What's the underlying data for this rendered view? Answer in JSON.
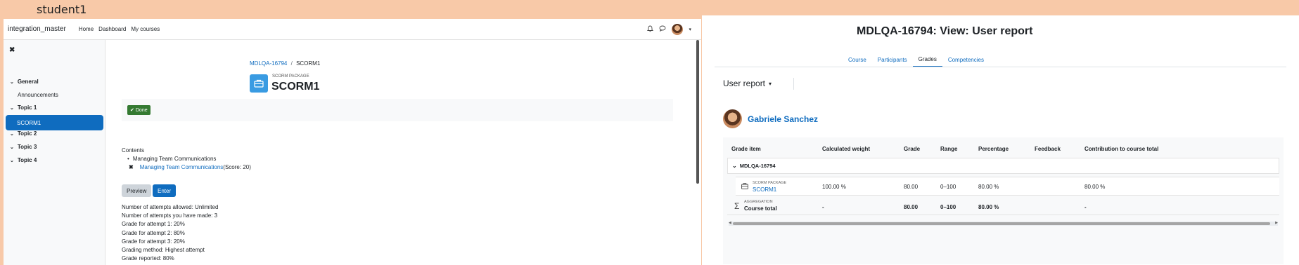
{
  "user_label": "student1",
  "left": {
    "navbar": {
      "brand": "integration_master",
      "links": [
        "Home",
        "Dashboard",
        "My courses"
      ],
      "icons": [
        "bell-icon",
        "chat-icon",
        "avatar",
        "chevron-down-icon"
      ]
    },
    "sidebar": {
      "sections": [
        {
          "label": "General"
        },
        {
          "label": "Topic 1"
        },
        {
          "label": "Topic 2"
        },
        {
          "label": "Topic 3"
        },
        {
          "label": "Topic 4"
        }
      ],
      "general_items": [
        "Announcements"
      ],
      "topic1_items": [
        "SCORM1"
      ]
    },
    "breadcrumb": {
      "parent": "MDLQA-16794",
      "sep": "/",
      "current": "SCORM1"
    },
    "module": {
      "kind": "SCORM PACKAGE",
      "title": "SCORM1"
    },
    "done_label": "Done",
    "contents": {
      "heading": "Contents",
      "items": [
        {
          "text": "Managing Team Communications"
        },
        {
          "link": "Managing Team Communications",
          "suffix": "(Score: 20)"
        }
      ]
    },
    "buttons": {
      "preview": "Preview",
      "enter": "Enter"
    },
    "attempts": [
      "Number of attempts allowed: Unlimited",
      "Number of attempts you have made: 3",
      "Grade for attempt 1: 20%",
      "Grade for attempt 2: 80%",
      "Grade for attempt 3: 20%",
      "Grading method: Highest attempt",
      "Grade reported: 80%"
    ]
  },
  "right": {
    "title": "MDLQA-16794: View: User report",
    "tabs": [
      "Course",
      "Participants",
      "Grades",
      "Competencies"
    ],
    "active_tab": "Grades",
    "report_selector": "User report",
    "user_name": "Gabriele Sanchez",
    "table": {
      "headers": [
        "Grade item",
        "Calculated weight",
        "Grade",
        "Range",
        "Percentage",
        "Feedback",
        "Contribution to course total"
      ],
      "category": "MDLQA-16794",
      "rows": [
        {
          "kind": "SCORM PACKAGE",
          "name": "SCORM1",
          "weight": "100.00 %",
          "grade": "80.00",
          "range": "0–100",
          "percentage": "80.00 %",
          "feedback": "",
          "contribution": "80.00 %"
        },
        {
          "kind": "AGGREGATION",
          "name": "Course total",
          "weight": "-",
          "grade": "80.00",
          "range": "0–100",
          "percentage": "80.00 %",
          "feedback": "",
          "contribution": "-"
        }
      ]
    }
  }
}
